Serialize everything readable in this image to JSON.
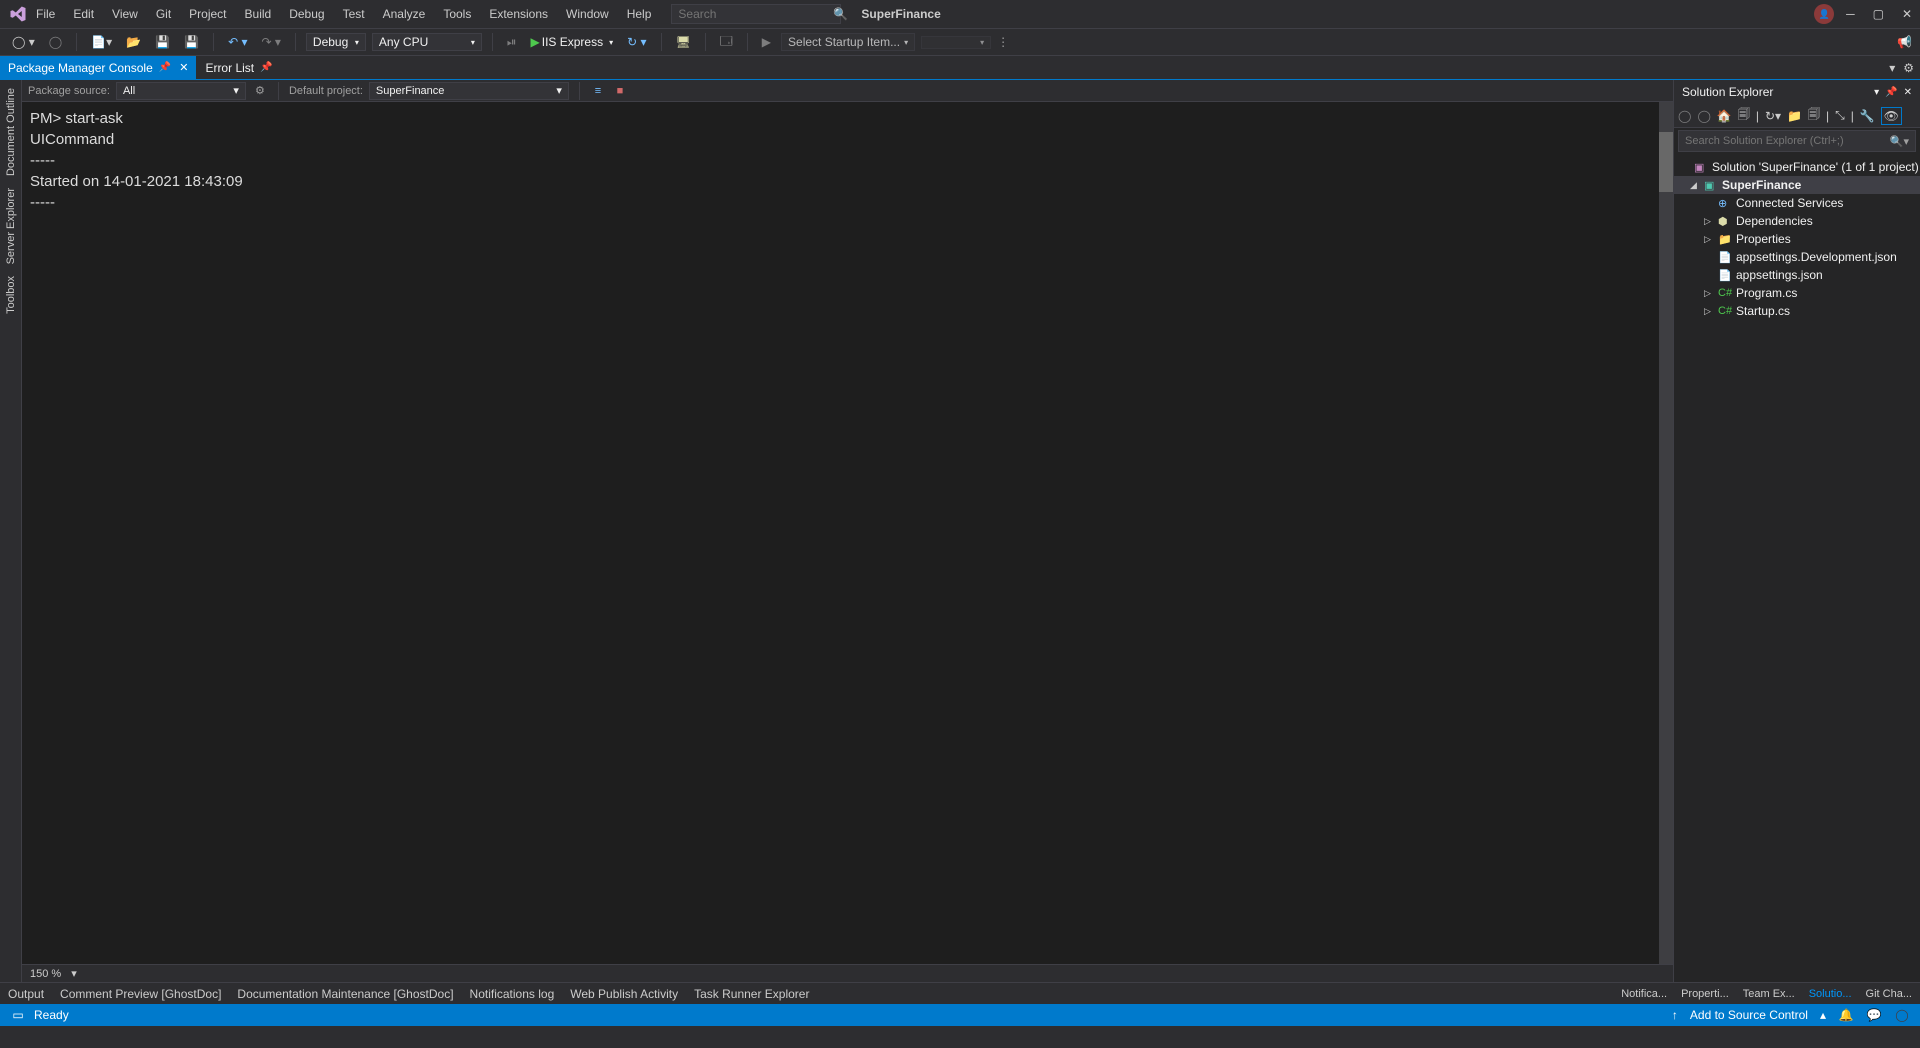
{
  "titlebar": {
    "menu": [
      "File",
      "Edit",
      "View",
      "Git",
      "Project",
      "Build",
      "Debug",
      "Test",
      "Analyze",
      "Tools",
      "Extensions",
      "Window",
      "Help"
    ],
    "search_placeholder": "Search",
    "app_title": "SuperFinance"
  },
  "toolbar": {
    "config": "Debug",
    "platform": "Any CPU",
    "run_label": "IIS Express",
    "startup_placeholder": "Select Startup Item..."
  },
  "tabs": {
    "active": "Package Manager Console",
    "other": "Error List"
  },
  "pmc": {
    "package_source_label": "Package source:",
    "package_source_value": "All",
    "default_project_label": "Default project:",
    "default_project_value": "SuperFinance"
  },
  "console": {
    "line1": "PM> start-ask",
    "line2": "",
    "line3": "UICommand",
    "line4": "-----",
    "line5": "Started on 14-01-2021 18:43:09",
    "line6": "-----"
  },
  "zoom": "150 %",
  "solution_explorer": {
    "title": "Solution Explorer",
    "search_placeholder": "Search Solution Explorer (Ctrl+;)",
    "solution": "Solution 'SuperFinance' (1 of 1 project)",
    "project": "SuperFinance",
    "items": {
      "connected": "Connected Services",
      "dependencies": "Dependencies",
      "properties": "Properties",
      "appsettings_dev": "appsettings.Development.json",
      "appsettings": "appsettings.json",
      "program": "Program.cs",
      "startup": "Startup.cs"
    }
  },
  "bottom_tabs": {
    "left": [
      "Output",
      "Comment Preview [GhostDoc]",
      "Documentation Maintenance [GhostDoc]",
      "Notifications log",
      "Web Publish Activity",
      "Task Runner Explorer"
    ],
    "right": [
      "Notifica...",
      "Properti...",
      "Team Ex...",
      "Solutio...",
      "Git Cha..."
    ]
  },
  "statusbar": {
    "status": "Ready",
    "source_control": "Add to Source Control"
  },
  "left_rail": [
    "Document Outline",
    "Server Explorer",
    "Toolbox"
  ]
}
